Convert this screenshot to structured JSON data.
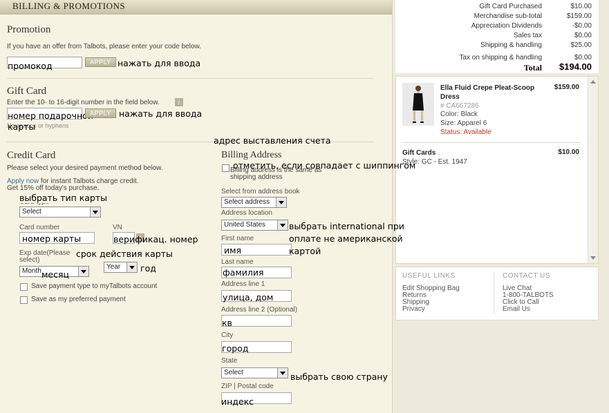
{
  "header": {
    "title": "BILLING & PROMOTIONS"
  },
  "promotion": {
    "title": "Promotion",
    "desc": "If you have an offer from Talbots, please enter your code below.",
    "code_value": "промокод",
    "apply_label": "APPLY",
    "apply_note": "нажать для ввода"
  },
  "gift_card": {
    "title": "Gift Card",
    "desc": "Enter the 10- to 16-digit number in the field below.",
    "value": "номер подарочной карты",
    "value_line1": "номер подарочной",
    "value_line2": "карты",
    "hint": "No spaces or hyphens",
    "apply_label": "APPLY",
    "apply_note": "нажать для ввода"
  },
  "credit_card": {
    "title": "Credit Card",
    "desc": "Please select your desired payment method below.",
    "apply_link": "Apply now",
    "apply_text": "for instant Talbots charge credit.",
    "discount": "Get 15% off today's purchase.",
    "card_type_label": "Card type",
    "card_type_value": "Select",
    "card_type_note": "выбрать тип карты",
    "card_number_label": "Card number",
    "card_number_value": "номер карты",
    "vn_label": "VN",
    "vn_value": "верификац. номер",
    "exp_label": "Exp date(Please select)",
    "exp_note": "срок действия карты",
    "month_value": "Month",
    "month_note": "месяц",
    "year_value": "Year",
    "year_note": "год",
    "save_type_label": "Save payment type to myTalbots account",
    "save_pref_label": "Save as my preferred payment"
  },
  "billing": {
    "note_title": "адрес выставления счета",
    "title": "Billing Address",
    "same_label": "Billing address is the same as shipping address",
    "same_note": "отметить, если совпадает с шиппингом",
    "address_book_label": "Select from address book",
    "address_book_value": "Select address",
    "location_label": "Address location",
    "location_value": "United States",
    "location_note_1": "выбрать international при",
    "location_note_2": "оплате не американской",
    "location_note_3": "картой",
    "first_name_label": "First name",
    "first_name_value": "имя",
    "last_name_label": "Last name",
    "last_name_value": "фамилия",
    "address1_label": "Address line 1",
    "address1_value": "улица, дом",
    "address2_label": "Address line 2 (Optional)",
    "address2_value": "кв",
    "city_label": "City",
    "city_value": "город",
    "state_label": "State",
    "state_value": "Select",
    "state_note": "выбрать свою страну",
    "zip_label": "ZIP | Postal code",
    "zip_value": "индекс"
  },
  "summary": {
    "rows": [
      {
        "label": "Gift Card Purchased",
        "value": "$10.00"
      },
      {
        "label": "Merchandise sub-total",
        "value": "$159.00"
      },
      {
        "label": "Appreciation Dividends",
        "value": "-$0.00"
      },
      {
        "label": "Sales tax",
        "value": "$0.00"
      },
      {
        "label": "Shipping & handling",
        "value": "$25.00"
      },
      {
        "label": "Tax on shipping & handling",
        "value": "$0.00"
      }
    ],
    "total_label": "Total",
    "total_value": "$194.00"
  },
  "cart": {
    "item_name_1": "Ella Fluid Crepe Pleat-Scoop",
    "item_name_2": "Dress",
    "item_price": "$159.00",
    "item_sku": "# CA667286",
    "item_color": "Color: Black",
    "item_size": "Size: Apparel 6",
    "item_status": "Status: Available",
    "gift_title": "Gift Cards",
    "gift_price": "$10.00",
    "gift_style": "Style: GC - Est. 1947"
  },
  "footer": {
    "useful_title": "USEFUL LINKS",
    "useful_links": [
      "Edit Shopping Bag",
      "Returns",
      "Shipping",
      "Privacy"
    ],
    "contact_title": "CONTACT US",
    "contact_links": [
      "Live Chat",
      "1-800-TALBOTS",
      "Click to Call",
      "Email Us"
    ]
  },
  "colors": {
    "accent_link": "#3a6e9a",
    "status_red": "#c0392b",
    "panel_bg": "#f6f3e3"
  }
}
